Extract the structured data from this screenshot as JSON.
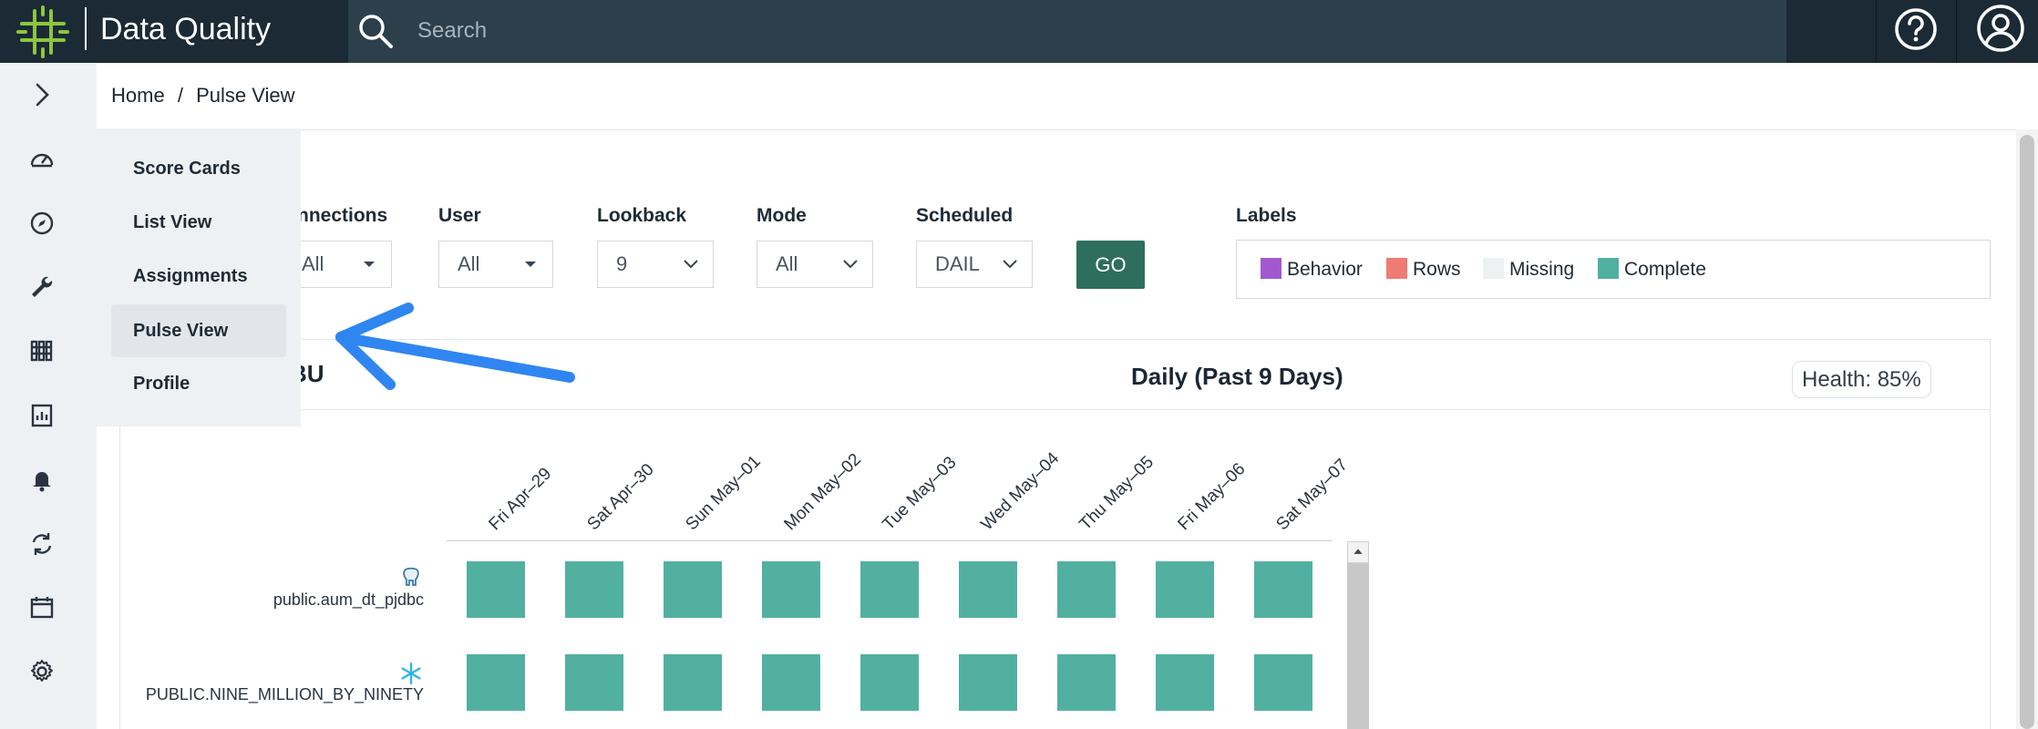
{
  "app": {
    "title": "Data Quality"
  },
  "search": {
    "placeholder": "Search"
  },
  "header_icons": [
    "help-icon",
    "user-icon"
  ],
  "left_rail": {
    "icons": [
      "chevron-right-icon",
      "dashboard-gauge-icon",
      "compass-icon",
      "wrench-icon",
      "catalog-icon",
      "report-icon",
      "bell-icon",
      "refresh-icon",
      "calendar-icon",
      "gear-icon"
    ]
  },
  "flyout": {
    "items": [
      {
        "label": "Score Cards",
        "active": false
      },
      {
        "label": "List View",
        "active": false
      },
      {
        "label": "Assignments",
        "active": false
      },
      {
        "label": "Pulse View",
        "active": true
      },
      {
        "label": "Profile",
        "active": false
      }
    ]
  },
  "breadcrumb": {
    "home": "Home",
    "separator": "/",
    "current": "Pulse View"
  },
  "filters": {
    "connections": {
      "label": "nnections",
      "value": "All"
    },
    "user": {
      "label": "User",
      "value": "All"
    },
    "lookback": {
      "label": "Lookback",
      "value": "9"
    },
    "mode": {
      "label": "Mode",
      "value": "All"
    },
    "scheduled": {
      "label": "Scheduled",
      "value": "DAIL"
    },
    "go_label": "GO"
  },
  "labels": {
    "title": "Labels",
    "items": [
      {
        "name": "Behavior",
        "color": "#a259cf"
      },
      {
        "name": "Rows",
        "color": "#ef7b73"
      },
      {
        "name": "Missing",
        "color": "#edf1f2"
      },
      {
        "name": "Complete",
        "color": "#52b0a1"
      }
    ]
  },
  "panel": {
    "left_title": "BU",
    "title": "Daily (Past 9 Days)",
    "health": "Health: 85%"
  },
  "pulse": {
    "dates": [
      "Fri Apr–29",
      "Sat Apr–30",
      "Sun May–01",
      "Mon May–02",
      "Tue May–03",
      "Wed May–04",
      "Thu May–05",
      "Fri May–06",
      "Sat May–07"
    ],
    "rows": [
      {
        "name": "public.aum_dt_pjdbc",
        "db_icon": "postgresql-icon",
        "statuses": [
          "Complete",
          "Complete",
          "Complete",
          "Complete",
          "Complete",
          "Complete",
          "Complete",
          "Complete",
          "Complete"
        ]
      },
      {
        "name": "PUBLIC.NINE_MILLION_BY_NINETY",
        "db_icon": "snowflake-icon",
        "statuses": [
          "Complete",
          "Complete",
          "Complete",
          "Complete",
          "Complete",
          "Complete",
          "Complete",
          "Complete",
          "Complete"
        ]
      }
    ],
    "complete_color": "#52b0a1"
  }
}
